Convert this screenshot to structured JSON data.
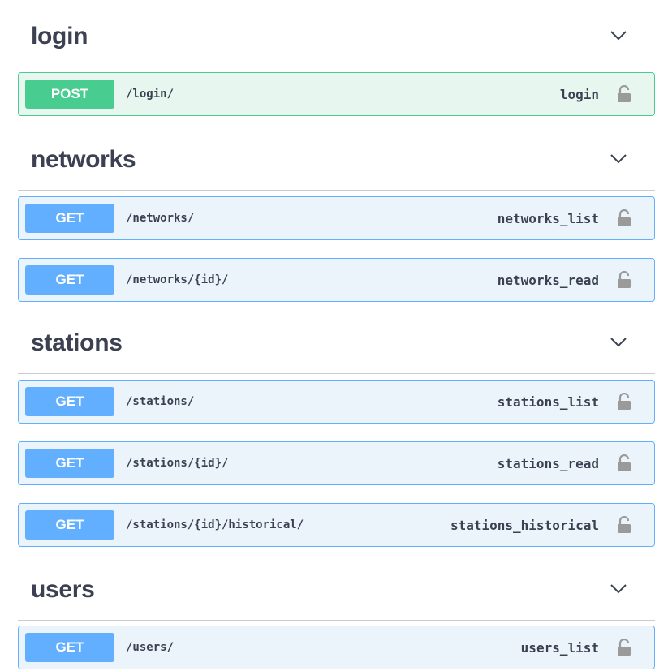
{
  "groups": [
    {
      "name": "login",
      "operations": [
        {
          "method": "POST",
          "path": "/login/",
          "summary": "login"
        }
      ]
    },
    {
      "name": "networks",
      "operations": [
        {
          "method": "GET",
          "path": "/networks/",
          "summary": "networks_list"
        },
        {
          "method": "GET",
          "path": "/networks/{id}/",
          "summary": "networks_read"
        }
      ]
    },
    {
      "name": "stations",
      "operations": [
        {
          "method": "GET",
          "path": "/stations/",
          "summary": "stations_list"
        },
        {
          "method": "GET",
          "path": "/stations/{id}/",
          "summary": "stations_read"
        },
        {
          "method": "GET",
          "path": "/stations/{id}/historical/",
          "summary": "stations_historical"
        }
      ]
    },
    {
      "name": "users",
      "operations": [
        {
          "method": "GET",
          "path": "/users/",
          "summary": "users_list"
        }
      ]
    }
  ],
  "icons": {
    "collapse": "chevron-down-icon",
    "auth": "unlocked-lock-icon"
  },
  "colors": {
    "get": "#61affe",
    "get_bg": "#ebf3fb",
    "post": "#49cc90",
    "post_bg": "#e8f6f0",
    "text": "#3b4151"
  }
}
